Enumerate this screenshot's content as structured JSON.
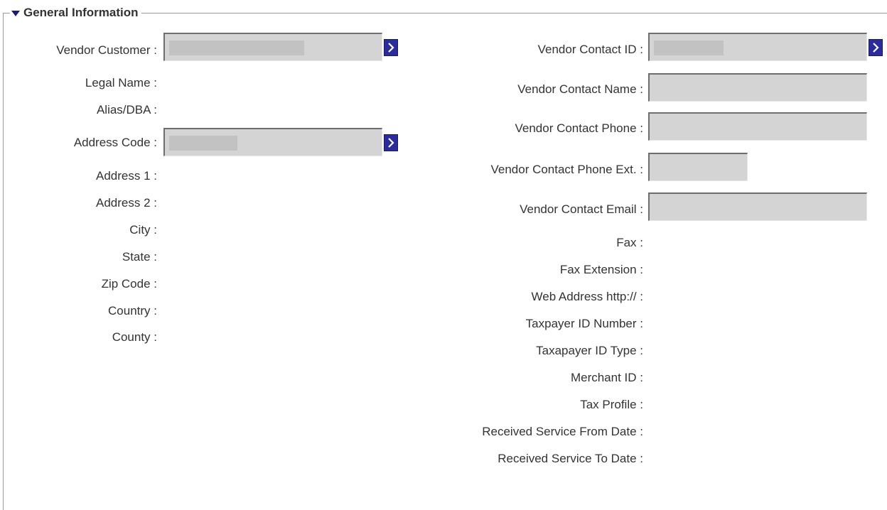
{
  "section": {
    "title": "General Information"
  },
  "left": {
    "vendor_customer": "Vendor Customer :",
    "legal_name": "Legal Name :",
    "alias_dba": "Alias/DBA :",
    "address_code": "Address Code :",
    "address1": "Address 1 :",
    "address2": "Address 2 :",
    "city": "City :",
    "state": "State :",
    "zip_code": "Zip Code :",
    "country": "Country :",
    "county": "County :"
  },
  "right": {
    "vendor_contact_id": "Vendor Contact ID :",
    "vendor_contact_name": "Vendor Contact Name :",
    "vendor_contact_phone": "Vendor Contact Phone :",
    "vendor_contact_phone_ext": "Vendor Contact Phone Ext. :",
    "vendor_contact_email": "Vendor Contact Email :",
    "fax": "Fax :",
    "fax_extension": "Fax Extension :",
    "web_address": "Web Address http:// :",
    "taxpayer_id_number": "Taxpayer ID Number :",
    "taxpayer_id_type": "Taxapayer ID Type :",
    "merchant_id": "Merchant ID :",
    "tax_profile": "Tax Profile :",
    "received_from": "Received Service From Date :",
    "received_to": "Received Service To Date :"
  },
  "colors": {
    "field_bg": "#d4d4d4",
    "lookup_button": "#2b2ba0"
  },
  "icons": {
    "collapse": "caret-down-icon",
    "lookup": "chevron-right-icon"
  }
}
